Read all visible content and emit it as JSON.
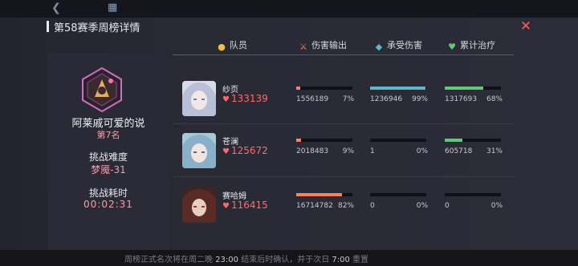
{
  "panel": {
    "title": "第58赛季周榜详情"
  },
  "player": {
    "name": "阿莱戚可爱的说",
    "rank": "第7名",
    "difficulty_label": "挑战难度",
    "difficulty_value": "梦魇-31",
    "time_label": "挑战耗时",
    "time_value": "00:02:31"
  },
  "columns": {
    "member": "队员",
    "damage": "伤害输出",
    "taken": "承受伤害",
    "heal": "累计治疗"
  },
  "members": [
    {
      "name": "纱页",
      "score": "133139",
      "damage": {
        "value": "1556189",
        "pct": "7%",
        "fraction": 0.07
      },
      "taken": {
        "value": "1236946",
        "pct": "99%",
        "fraction": 0.99
      },
      "heal": {
        "value": "1317693",
        "pct": "68%",
        "fraction": 0.68
      }
    },
    {
      "name": "苍澜",
      "score": "125672",
      "damage": {
        "value": "2018483",
        "pct": "9%",
        "fraction": 0.09
      },
      "taken": {
        "value": "1",
        "pct": "0%",
        "fraction": 0.0
      },
      "heal": {
        "value": "605718",
        "pct": "31%",
        "fraction": 0.31
      }
    },
    {
      "name": "赛哈姆",
      "score": "116415",
      "damage": {
        "value": "16714782",
        "pct": "82%",
        "fraction": 0.82
      },
      "taken": {
        "value": "0",
        "pct": "0%",
        "fraction": 0.0
      },
      "heal": {
        "value": "0",
        "pct": "0%",
        "fraction": 0.0
      }
    }
  ],
  "footer": {
    "notice_a": "周榜正式名次将在周二晚",
    "notice_time1": "23:00",
    "notice_b": "结束后时确认，并于次日",
    "notice_time2": "7:00",
    "notice_c": "重置"
  },
  "colors": {
    "damage": "#ff8060",
    "taken": "#5ab8c8",
    "heal": "#60c878",
    "accent": "#ff5a5a"
  },
  "icons": {
    "back": "back-icon",
    "building": "building-icon",
    "close": "close-icon",
    "member": "member-icon",
    "damage": "sword-icon",
    "taken": "shield-icon",
    "heal": "heart-icon"
  }
}
